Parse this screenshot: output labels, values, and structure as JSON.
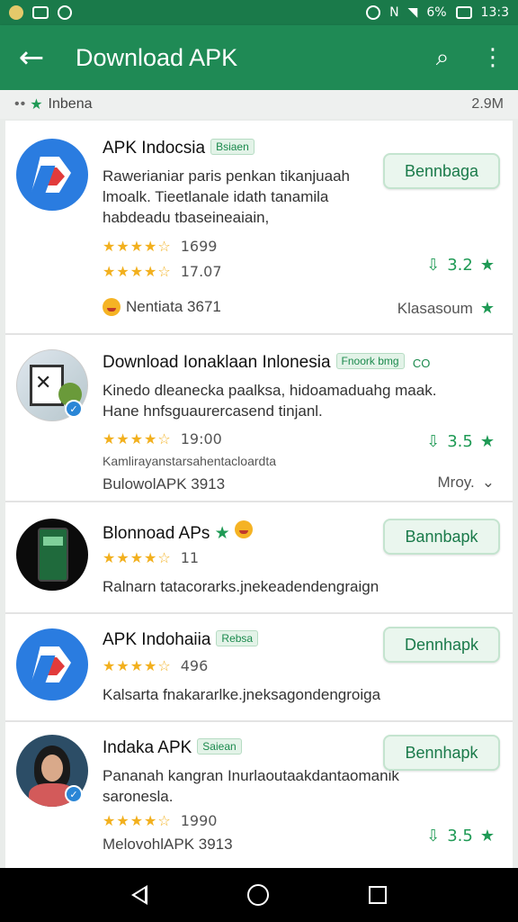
{
  "status": {
    "percent": "6%",
    "time": "13:3"
  },
  "appbar": {
    "title": "Download APK",
    "back_glyph": "←",
    "search_glyph": "⌕",
    "menu_glyph": "⋮"
  },
  "subheader": {
    "dots": "••",
    "label": "Inbena",
    "size": "2.9M"
  },
  "apps": [
    {
      "name": "APK Indocsia",
      "badge": "Bsiaen",
      "desc": "Rawerianiar paris penkan tikanjuaah lmoalk. Tieetlanale idath tanamila habdeadu tbaseineaiain,",
      "stars": "★★★★☆",
      "count": "1699",
      "stars2": "★★★★☆",
      "count2": "17.07",
      "meta": "Nentiata 3671",
      "side_label": "Klasasoum",
      "button": "Bennbaga",
      "score": "3.2"
    },
    {
      "name": "Download Ionaklaan Inlonesia",
      "badge": "Fnoork bmg",
      "badge_extra": "CO",
      "desc": "Kinedo dleanecka paalksa, hidoamaduahg maak. Hane hnfsguaurercasend tinjanl.",
      "stars": "★★★★☆",
      "count": "19:00",
      "meta2": "Kamlirayanstarsahentacloardta",
      "meta": "BulowolAPK 3913",
      "side_label": "Mroy.",
      "chevron": "⌄",
      "score": "3.5"
    },
    {
      "name": "Blonnoad APs",
      "stars": "★★★★☆",
      "count": "11",
      "desc": "Ralnarn tatacorarks.jnekeadendengraign",
      "button": "Bannbapk"
    },
    {
      "name": "APK Indohaiia",
      "badge": "Rebsa",
      "stars": "★★★★☆",
      "count": "496",
      "desc": "Kalsarta fnakararlke.jneksagondengroiga",
      "button": "Dennhapk"
    },
    {
      "name": "Indaka APK",
      "badge": "Saiean",
      "desc": "Pananah kangran Inurlaoutaakdantaomanik saronesla.",
      "stars": "★★★★☆",
      "count": "1990",
      "meta": "MelovohlAPK 3913",
      "button": "Bennhapk",
      "score": "3.5"
    }
  ],
  "colors": {
    "statusbar": "#1a7a4a",
    "appbar": "#1f8a55",
    "accent": "#1f9a55",
    "star": "#f2b01e"
  },
  "icons": [
    "app-logo-icon",
    "photo-avatar",
    "phone-avatar",
    "girl-avatar",
    "verified-icon",
    "download-score-icon",
    "star-icon"
  ]
}
